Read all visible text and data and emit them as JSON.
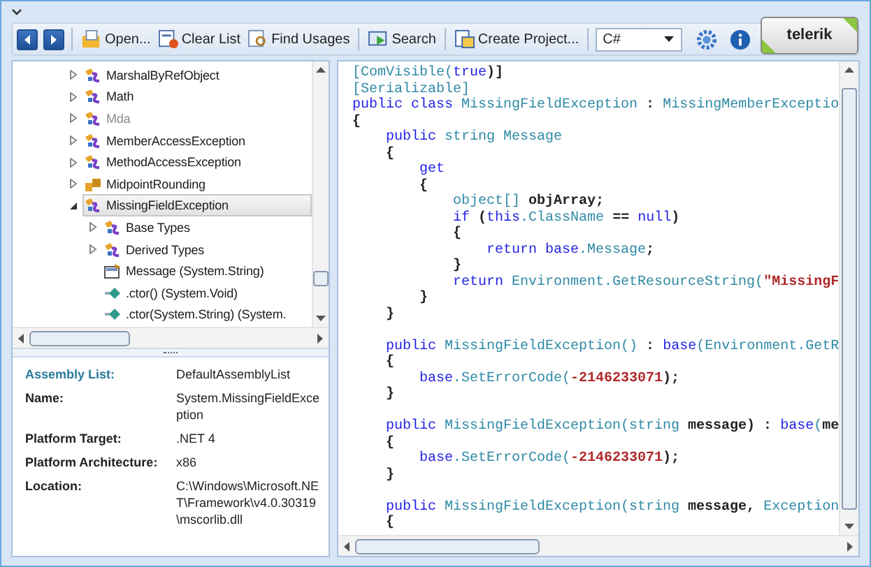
{
  "toolbar": {
    "nav": [
      {
        "kind": "back",
        "disabled": false
      },
      {
        "kind": "forward",
        "disabled": false
      }
    ],
    "buttons": [
      {
        "kind": "open",
        "label": "Open..."
      },
      {
        "kind": "clear",
        "label": "Clear List"
      },
      {
        "kind": "usages",
        "label": "Find Usages"
      },
      {
        "kind": "search",
        "label": "Search"
      },
      {
        "kind": "project",
        "label": "Create Project..."
      }
    ],
    "language": {
      "value": "C#"
    },
    "logo": {
      "text": "telerik"
    }
  },
  "tree": {
    "items": [
      {
        "label": "MarshalByRefObject",
        "kind": "class",
        "expanded": false,
        "dimmed": false,
        "selected": false
      },
      {
        "label": "Math",
        "kind": "class",
        "expanded": false,
        "dimmed": false,
        "selected": false
      },
      {
        "label": "Mda",
        "kind": "class",
        "expanded": false,
        "dimmed": true,
        "selected": false
      },
      {
        "label": "MemberAccessException",
        "kind": "class",
        "expanded": false,
        "dimmed": false,
        "selected": false
      },
      {
        "label": "MethodAccessException",
        "kind": "class",
        "expanded": false,
        "dimmed": false,
        "selected": false
      },
      {
        "label": "MidpointRounding",
        "kind": "enum",
        "expanded": false,
        "dimmed": false,
        "selected": false
      },
      {
        "label": "MissingFieldException",
        "kind": "class",
        "expanded": true,
        "dimmed": false,
        "selected": true,
        "children": [
          {
            "label": "Base Types",
            "kind": "class",
            "expanded": false,
            "dimmed": false,
            "selected": false
          },
          {
            "label": "Derived Types",
            "kind": "class",
            "expanded": false,
            "dimmed": false,
            "selected": false
          },
          {
            "label": "Message (System.String)",
            "kind": "property",
            "dimmed": false,
            "selected": false
          },
          {
            "label": ".ctor() (System.Void)",
            "kind": "method",
            "dimmed": false,
            "selected": false
          },
          {
            "label": ".ctor(System.String) (System.",
            "kind": "method",
            "dimmed": false,
            "selected": false
          }
        ]
      }
    ]
  },
  "details": [
    {
      "label": "Assembly List:",
      "value": "DefaultAssemblyList",
      "accent": true
    },
    {
      "label": "Name:",
      "value": "System.MissingFieldException",
      "accent": false
    },
    {
      "label": "Platform Target:",
      "value": ".NET 4",
      "accent": false
    },
    {
      "label": "Platform Architecture:",
      "value": "x86",
      "accent": false
    },
    {
      "label": "Location:",
      "value": "C:\\Windows\\Microsoft.NET\\Framework\\v4.0.30319\\mscorlib.dll",
      "accent": false
    }
  ],
  "code": {
    "blocks": [
      {
        "lines": [
          [
            {
              "kind": "type",
              "text": "[ComVisible("
            },
            {
              "kind": "kw",
              "text": "true"
            },
            {
              "kind": "plain",
              "text": ")]"
            }
          ],
          [
            {
              "kind": "type",
              "text": "[Serializable]"
            }
          ],
          [
            {
              "kind": "kw",
              "text": "public class "
            },
            {
              "kind": "type",
              "text": "MissingFieldException"
            },
            {
              "kind": "plain",
              "text": " : "
            },
            {
              "kind": "type",
              "text": "MissingMemberExceptio"
            }
          ],
          [
            {
              "kind": "plain",
              "text": "{"
            }
          ],
          [
            {
              "kind": "kw",
              "text": "    public "
            },
            {
              "kind": "type",
              "text": "string Message"
            }
          ],
          [
            {
              "kind": "plain",
              "text": "    {"
            }
          ],
          [
            {
              "kind": "kw",
              "text": "        get"
            }
          ],
          [
            {
              "kind": "plain",
              "text": "        {"
            }
          ],
          [
            {
              "kind": "type",
              "text": "            object[]"
            },
            {
              "kind": "plain",
              "text": " objArray;"
            }
          ],
          [
            {
              "kind": "kw",
              "text": "            if"
            },
            {
              "kind": "plain",
              "text": " ("
            },
            {
              "kind": "kw",
              "text": "this"
            },
            {
              "kind": "type",
              "text": ".ClassName"
            },
            {
              "kind": "plain",
              "text": " == "
            },
            {
              "kind": "kw",
              "text": "null"
            },
            {
              "kind": "plain",
              "text": ")"
            }
          ],
          [
            {
              "kind": "plain",
              "text": "            {"
            }
          ],
          [
            {
              "kind": "kw",
              "text": "                return base"
            },
            {
              "kind": "type",
              "text": ".Message"
            },
            {
              "kind": "plain",
              "text": ";"
            }
          ],
          [
            {
              "kind": "plain",
              "text": "            }"
            }
          ],
          [
            {
              "kind": "kw",
              "text": "            return "
            },
            {
              "kind": "type",
              "text": "Environment.GetResourceString("
            },
            {
              "kind": "str",
              "text": "\"MissingF"
            }
          ],
          [
            {
              "kind": "plain",
              "text": "        }"
            }
          ],
          [
            {
              "kind": "plain",
              "text": "    }"
            }
          ]
        ]
      },
      {
        "lines": [
          [
            {
              "kind": "kw",
              "text": "    public "
            },
            {
              "kind": "type",
              "text": "MissingFieldException()"
            },
            {
              "kind": "plain",
              "text": " : "
            },
            {
              "kind": "kw",
              "text": "base"
            },
            {
              "kind": "type",
              "text": "(Environment.GetR"
            }
          ],
          [
            {
              "kind": "plain",
              "text": "    {"
            }
          ],
          [
            {
              "kind": "kw",
              "text": "        base"
            },
            {
              "kind": "type",
              "text": ".SetErrorCode("
            },
            {
              "kind": "str",
              "text": "-2146233071"
            },
            {
              "kind": "plain",
              "text": ");"
            }
          ],
          [
            {
              "kind": "plain",
              "text": "    }"
            }
          ]
        ]
      },
      {
        "lines": [
          [
            {
              "kind": "kw",
              "text": "    public "
            },
            {
              "kind": "type",
              "text": "MissingFieldException(string"
            },
            {
              "kind": "plain",
              "text": " message) : "
            },
            {
              "kind": "kw",
              "text": "base"
            },
            {
              "kind": "type",
              "text": "("
            },
            {
              "kind": "plain",
              "text": "me"
            }
          ],
          [
            {
              "kind": "plain",
              "text": "    {"
            }
          ],
          [
            {
              "kind": "kw",
              "text": "        base"
            },
            {
              "kind": "type",
              "text": ".SetErrorCode("
            },
            {
              "kind": "str",
              "text": "-2146233071"
            },
            {
              "kind": "plain",
              "text": ");"
            }
          ],
          [
            {
              "kind": "plain",
              "text": "    }"
            }
          ]
        ]
      },
      {
        "lines": [
          [
            {
              "kind": "kw",
              "text": "    public "
            },
            {
              "kind": "type",
              "text": "MissingFieldException(string"
            },
            {
              "kind": "plain",
              "text": " message, "
            },
            {
              "kind": "type",
              "text": "Exception"
            }
          ],
          [
            {
              "kind": "plain",
              "text": "    {"
            }
          ]
        ]
      }
    ]
  }
}
